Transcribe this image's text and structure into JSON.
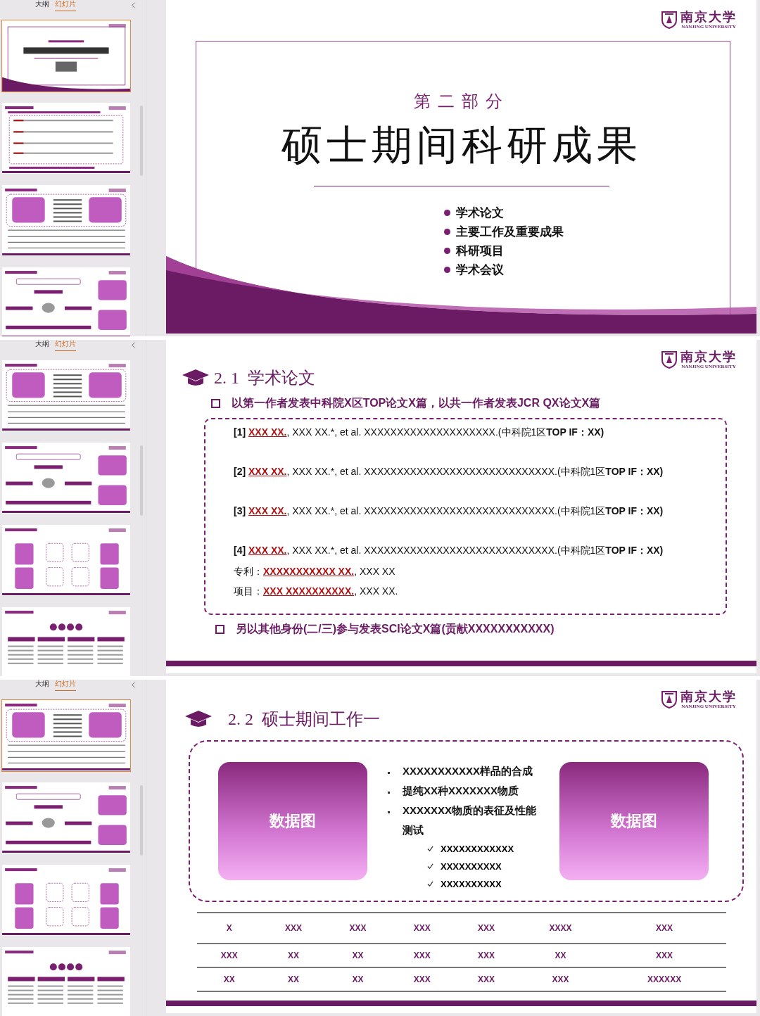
{
  "panels": [
    {
      "tabs": [
        {
          "label": "大纲",
          "selected": false
        },
        {
          "label": "幻灯片",
          "selected": true
        }
      ],
      "thumbnails": [
        {
          "kind": "section",
          "selected": true
        },
        {
          "kind": "papers",
          "selected": false
        },
        {
          "kind": "work1",
          "selected": false
        },
        {
          "kind": "work2",
          "selected": false
        }
      ],
      "slide": {
        "kind": "section",
        "logo": {
          "name": "南京大学",
          "subtitle": "NANJING UNIVERSITY"
        },
        "part": "第二部分",
        "title": "硕士期间科研成果",
        "bullets": [
          "学术论文",
          "主要工作及重要成果",
          "科研项目",
          "学术会议"
        ]
      }
    },
    {
      "tabs": [
        {
          "label": "大纲",
          "selected": false
        },
        {
          "label": "幻灯片",
          "selected": true
        }
      ],
      "thumbnails": [
        {
          "kind": "work1",
          "selected": false
        },
        {
          "kind": "work2",
          "selected": false
        },
        {
          "kind": "work3",
          "selected": false
        },
        {
          "kind": "results",
          "selected": false
        }
      ],
      "slide": {
        "kind": "papers",
        "logo": {
          "name": "南京大学",
          "subtitle": "NANJING UNIVERSITY"
        },
        "heading": "2. 1  学术论文",
        "claim": "以第一作者发表中科院X区TOP论文X篇，以共一作者发表JCR QX论文X篇",
        "references": [
          {
            "number": "[1]",
            "author": "XXX XX.",
            "rest": ", XXX XX.*, et al. XXXXXXXXXXXXXXXXXXXX.(中科院1区**TOP  IF：XX)**"
          },
          {
            "number": "[2]",
            "author": "XXX XX.",
            "rest": ", XXX XX.*, et al. XXXXXXXXXXXXXXXXXXXXXXXXXXXXX.(中科院1区**TOP  IF：XX)**"
          },
          {
            "number": "[3]",
            "author": "XXX XX.",
            "rest": ", XXX XX.*, et al. XXXXXXXXXXXXXXXXXXXXXXXXXXXXX.(中科院1区**TOP  IF：XX)**"
          },
          {
            "number": "[4]",
            "author": "XXX XX.",
            "rest": ", XXX XX.*, et al. XXXXXXXXXXXXXXXXXXXXXXXXXXXXX.(中科院1区**TOP  IF：XX)**"
          }
        ],
        "extras": [
          {
            "label": "专利：",
            "value": "XXXXXXXXXXX XX.",
            "rest": ", XXX XX"
          },
          {
            "label": "项目：",
            "value": "XXX XXXXXXXXXX.",
            "rest": ", XXX XX."
          }
        ],
        "note": "另以其他身份(二/三)参与发表SCI论文X篇(贡献XXXXXXXXXXX)"
      }
    },
    {
      "tabs": [
        {
          "label": "大纲",
          "selected": false
        },
        {
          "label": "幻灯片",
          "selected": true
        }
      ],
      "thumbnails": [
        {
          "kind": "work1",
          "selected": true
        },
        {
          "kind": "work2",
          "selected": false
        },
        {
          "kind": "work3",
          "selected": false
        },
        {
          "kind": "results",
          "selected": false
        }
      ],
      "slide": {
        "kind": "work",
        "logo": {
          "name": "南京大学",
          "subtitle": "NANJING UNIVERSITY"
        },
        "heading": "2. 2  硕士期间工作一",
        "figures": [
          "数据图",
          "数据图"
        ],
        "bullets": [
          "XXXXXXXXXXX样品的合成",
          "提纯XX种XXXXXXX物质",
          "XXXXXXX物质的表征及性能测试"
        ],
        "checks": [
          "XXXXXXXXXXXX",
          "XXXXXXXXXX",
          "XXXXXXXXXX"
        ],
        "table": [
          [
            "X",
            "XXX",
            "XXX",
            "XXX",
            "XXX",
            "XXXX",
            "XXX"
          ],
          [
            "XXX",
            "XX",
            "XX",
            "XXX",
            "XXX",
            "XX",
            "XXX"
          ],
          [
            "XX",
            "XX",
            "XX",
            "XXX",
            "XXX",
            "XXX",
            "XXXXXX"
          ]
        ]
      }
    }
  ]
}
